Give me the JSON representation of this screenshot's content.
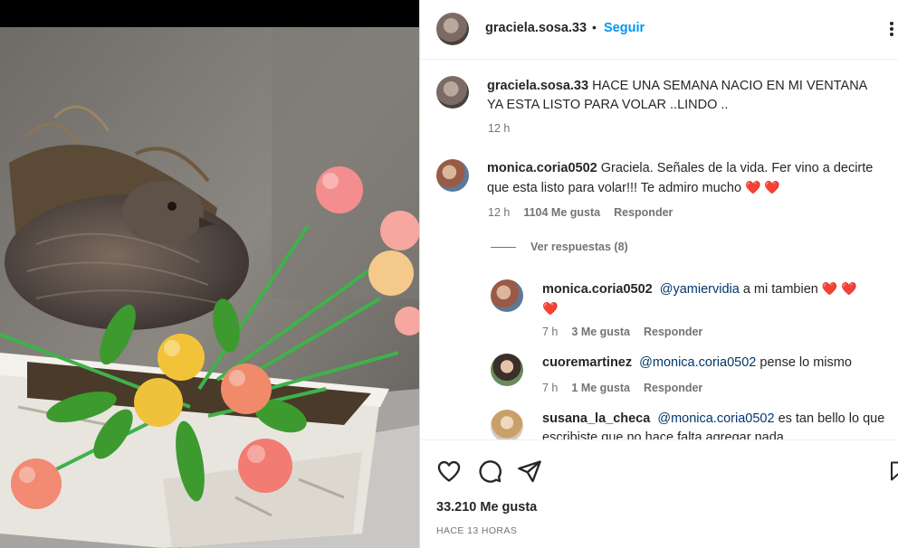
{
  "post": {
    "author": "graciela.sosa.33",
    "follow_separator": "•",
    "follow_label": "Seguir",
    "caption": "HACE UNA SEMANA NACIO EN MI VENTANA YA ESTA LISTO PARA VOLAR ..LINDO ..",
    "caption_time": "12 h",
    "likes": "33.210 Me gusta",
    "time_ago": "HACE 13 HORAS"
  },
  "comments": [
    {
      "user": "monica.coria0502",
      "text": "Graciela. Señales de la vida. Fer vino a decirte que esta listo para volar!!! Te admiro mucho",
      "hearts": "❤️ ❤️",
      "time": "12 h",
      "likes": "1104 Me gusta",
      "reply_label": "Responder",
      "view_replies": "Ver respuestas (8)"
    }
  ],
  "replies": [
    {
      "user": "monica.coria0502",
      "mention": "@yamiervidia",
      "text": "a mi tambien",
      "hearts_line1": "❤️ ❤️",
      "hearts_line2": "❤️",
      "time": "7 h",
      "likes": "3 Me gusta",
      "reply_label": "Responder"
    },
    {
      "user": "cuoremartinez",
      "mention": "@monica.coria0502",
      "text": "pense lo mismo",
      "time": "7 h",
      "likes": "1 Me gusta",
      "reply_label": "Responder"
    },
    {
      "user": "susana_la_checa",
      "mention": "@monica.coria0502",
      "text": "es tan bello lo que escribiste que no hace falta agregar nada"
    }
  ],
  "icons": {
    "like": "heart-outline-icon",
    "comment": "comment-bubble-icon",
    "share": "paper-plane-icon",
    "save": "bookmark-icon",
    "more": "vertical-dots-icon"
  },
  "colors": {
    "follow": "#0095f6",
    "heart": "#ed1c24",
    "mention": "#00376b",
    "secondary_text": "#737373"
  }
}
